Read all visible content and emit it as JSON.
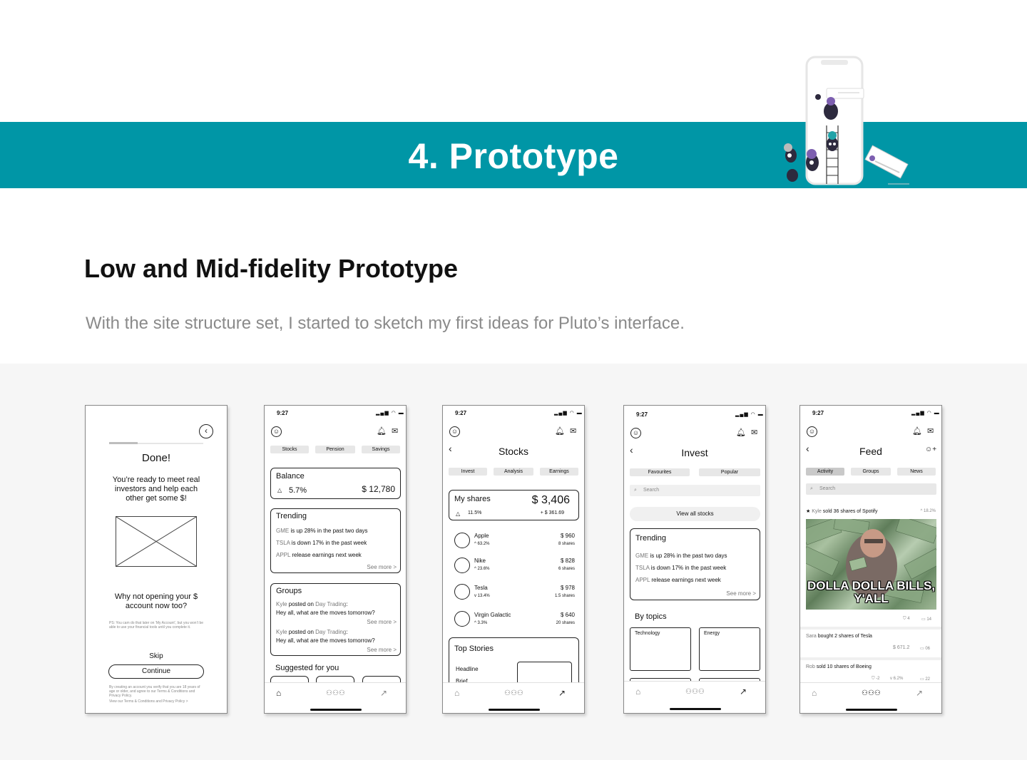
{
  "banner": {
    "title": "4. Prototype"
  },
  "section": {
    "heading": "Low and Mid-fidelity Prototype",
    "lead": "With the site structure set, I started to sketch my first ideas for Pluto’s interface."
  },
  "colors": {
    "brand_teal": "#0096a6",
    "gallery_bg": "#f6f6f6"
  },
  "status_time": "9:27",
  "screen1": {
    "title": "Done!",
    "message": "You’re ready to meet real investors and help each other get some $!",
    "question": "Why not opening your $ account now too?",
    "ps": "PS: You cam do that later on ‘My Account’, but you won’t be able to use your financial tools until you complete it.",
    "skip": "Skip",
    "continue": "Continue",
    "legal": "By creating an account you verify that you are 18 years of age or older, and agree to our Terms & Conditions and Privacy Policy.",
    "legal_link": "View our Terms & Conditions and Privacy Policy >"
  },
  "screen2": {
    "tabs": [
      "Stocks",
      "Pension",
      "Savings"
    ],
    "balance_label": "Balance",
    "balance_change": "5.7%",
    "balance_value": "$ 12,780",
    "trending_title": "Trending",
    "trending": [
      {
        "ticker": "GME",
        "text": " is up 28% in the past two days"
      },
      {
        "ticker": "TSLA",
        "text": " is down 17% in the past week"
      },
      {
        "ticker": "APPL",
        "text": " release earnings next week"
      }
    ],
    "see_more": "See more >",
    "groups_title": "Groups",
    "posts": [
      {
        "user": "Kyle",
        "verb": " posted on ",
        "group": "Day Trading",
        "colon": ":",
        "text": "Hey all, what are the moves tomorrow?"
      },
      {
        "user": "Kyle",
        "verb": " posted on ",
        "group": "Day Trading",
        "colon": ":",
        "text": "Hey all, what are the moves tomorrow?"
      }
    ],
    "suggested_title": "Suggested for you"
  },
  "screen3": {
    "title": "Stocks",
    "tabs": [
      "Invest",
      "Analysis",
      "Earnings"
    ],
    "my_shares_label": "My shares",
    "my_shares_value": "$ 3,406",
    "my_shares_pct": "11.5%",
    "my_shares_gain": "+ $ 361.69",
    "stocks": [
      {
        "name": "Apple",
        "change": "63.2%",
        "dir": "up",
        "value": "$ 960",
        "shares": "8 shares"
      },
      {
        "name": "Nike",
        "change": "23.6%",
        "dir": "up",
        "value": "$ 828",
        "shares": "6 shares"
      },
      {
        "name": "Tesla",
        "change": "13.4%",
        "dir": "down",
        "value": "$ 978",
        "shares": "1.5 shares"
      },
      {
        "name": "Virgin Galactic",
        "change": "3.3%",
        "dir": "up",
        "value": "$ 640",
        "shares": "20 shares"
      }
    ],
    "top_stories_title": "Top Stories",
    "headline": "Headline",
    "brief": "Brief"
  },
  "screen4": {
    "title": "Invest",
    "tabs": [
      "Favourites",
      "Popular"
    ],
    "search_placeholder": "Search",
    "view_all": "View all stocks",
    "trending_title": "Trending",
    "trending": [
      {
        "ticker": "GME",
        "text": " is up 28% in the past two days"
      },
      {
        "ticker": "TSLA",
        "text": " is down 17% in the past week"
      },
      {
        "ticker": "APPL",
        "text": " release earnings next week"
      }
    ],
    "see_more": "See more >",
    "by_topics": "By topics",
    "topics": [
      "Technology",
      "Energy"
    ]
  },
  "screen5": {
    "title": "Feed",
    "tabs": [
      "Activity",
      "Groups",
      "News"
    ],
    "search_placeholder": "Search",
    "item1": {
      "star": "★",
      "user": "Kyle",
      "action": " sold 36 shares of Spotify",
      "change": "18.2%",
      "meme_text": "DOLLA DOLLA BILLS, Y'ALL",
      "likes": "4",
      "comments": "14"
    },
    "item2": {
      "user": "Sara",
      "action": " bought 2 shares of Tesla",
      "value": "$ 671.2",
      "comments": "06"
    },
    "item3": {
      "user": "Rob",
      "action": " sold 10 shares of Boeing",
      "likes": "-2",
      "change": "6.2%",
      "comments": "22"
    }
  }
}
